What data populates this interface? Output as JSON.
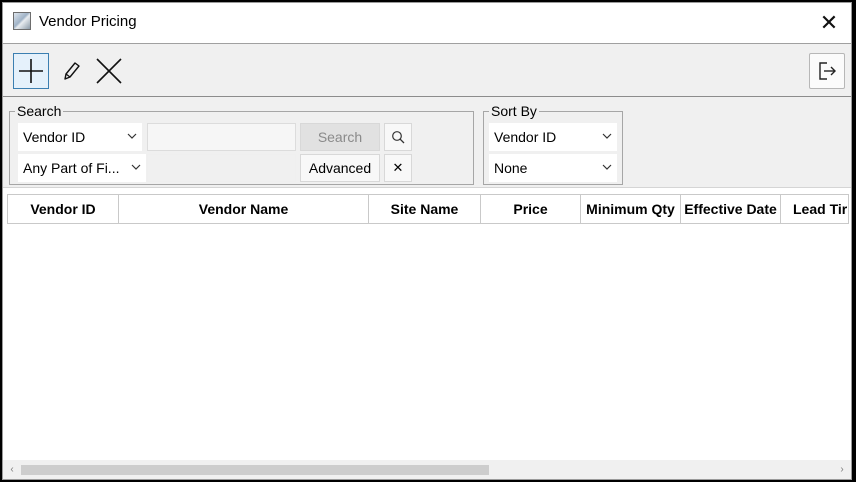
{
  "window": {
    "title": "Vendor Pricing",
    "close_glyph": "✕"
  },
  "toolbar": {
    "add_icon": "plus-icon",
    "edit_icon": "pencil-icon",
    "delete_icon": "x-icon",
    "exit_icon": "exit-icon"
  },
  "search": {
    "group_label": "Search",
    "field_select": "Vendor ID",
    "match_select": "Any Part of Fi...",
    "search_input_value": "",
    "search_button": "Search",
    "advanced_button": "Advanced",
    "clear_glyph": "✕"
  },
  "sort": {
    "group_label": "Sort By",
    "primary": "Vendor ID",
    "secondary": "None"
  },
  "table": {
    "columns": [
      "Vendor ID",
      "Vendor Name",
      "Site Name",
      "Price",
      "Minimum Qty",
      "Effective Date",
      "Lead Tir"
    ],
    "rows": []
  },
  "scrollbar": {
    "left_glyph": "‹",
    "right_glyph": "›"
  },
  "colors": {
    "accent": "#3c7fb1",
    "toolbar_bg": "#f0f0f0"
  }
}
